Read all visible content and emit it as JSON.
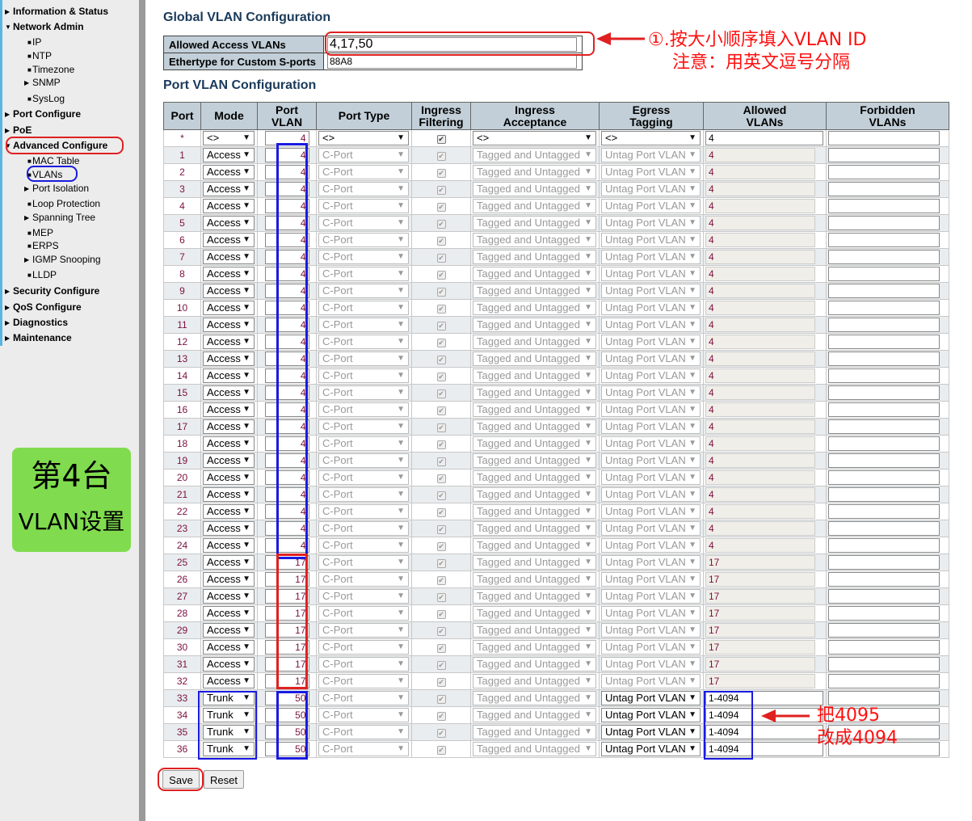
{
  "sidebar": {
    "items": [
      {
        "label": "Information & Status",
        "level": 0,
        "arrow": "right"
      },
      {
        "label": "Network Admin",
        "level": 0,
        "arrow": "down"
      },
      {
        "label": "IP",
        "level": 1
      },
      {
        "label": "NTP",
        "level": 1
      },
      {
        "label": "Timezone",
        "level": 1
      },
      {
        "label": "SNMP",
        "level": 1,
        "arrow": "right"
      },
      {
        "label": "SysLog",
        "level": 1
      },
      {
        "label": "Port Configure",
        "level": 0,
        "arrow": "right"
      },
      {
        "label": "PoE",
        "level": 0,
        "arrow": "right"
      },
      {
        "label": "Advanced Configure",
        "level": 0,
        "arrow": "down"
      },
      {
        "label": "MAC Table",
        "level": 1
      },
      {
        "label": "VLANs",
        "level": 1
      },
      {
        "label": "Port Isolation",
        "level": 1,
        "arrow": "right"
      },
      {
        "label": "Loop Protection",
        "level": 1
      },
      {
        "label": "Spanning Tree",
        "level": 1,
        "arrow": "right"
      },
      {
        "label": "MEP",
        "level": 1
      },
      {
        "label": "ERPS",
        "level": 1
      },
      {
        "label": "IGMP Snooping",
        "level": 1,
        "arrow": "right"
      },
      {
        "label": "LLDP",
        "level": 1
      },
      {
        "label": "Security Configure",
        "level": 0,
        "arrow": "right"
      },
      {
        "label": "QoS Configure",
        "level": 0,
        "arrow": "right"
      },
      {
        "label": "Diagnostics",
        "level": 0,
        "arrow": "right"
      },
      {
        "label": "Maintenance",
        "level": 0,
        "arrow": "right"
      }
    ],
    "badge": {
      "line1": "第4台",
      "line2": "VLAN设置",
      "color": "#80dc4e"
    }
  },
  "global": {
    "title": "Global VLAN Configuration",
    "allowed_label": "Allowed Access VLANs",
    "allowed_value": "4,17,50",
    "ethertype_label": "Ethertype for Custom S-ports",
    "ethertype_value": "88A8"
  },
  "port_section": {
    "title": "Port VLAN Configuration",
    "headers": {
      "port": "Port",
      "mode": "Mode",
      "pvid_1": "Port",
      "pvid_2": "VLAN",
      "type": "Port Type",
      "filter_1": "Ingress",
      "filter_2": "Filtering",
      "accept_1": "Ingress",
      "accept_2": "Acceptance",
      "egress_1": "Egress",
      "egress_2": "Tagging",
      "allowed_1": "Allowed",
      "allowed_2": "VLANs",
      "forbidden_1": "Forbidden",
      "forbidden_2": "VLANs"
    },
    "wildcard": {
      "port": "*",
      "mode": "<>",
      "pvid": "4",
      "type": "<>",
      "accept": "<>",
      "egress": "<>",
      "allowed": "4",
      "forbidden": ""
    },
    "rows": [
      {
        "port": "1",
        "mode": "Access",
        "pvid": "4",
        "type": "C-Port",
        "accept": "Tagged and Untagged",
        "egress": "Untag Port VLAN",
        "allowed": "4",
        "forbidden": ""
      },
      {
        "port": "2",
        "mode": "Access",
        "pvid": "4",
        "type": "C-Port",
        "accept": "Tagged and Untagged",
        "egress": "Untag Port VLAN",
        "allowed": "4",
        "forbidden": ""
      },
      {
        "port": "3",
        "mode": "Access",
        "pvid": "4",
        "type": "C-Port",
        "accept": "Tagged and Untagged",
        "egress": "Untag Port VLAN",
        "allowed": "4",
        "forbidden": ""
      },
      {
        "port": "4",
        "mode": "Access",
        "pvid": "4",
        "type": "C-Port",
        "accept": "Tagged and Untagged",
        "egress": "Untag Port VLAN",
        "allowed": "4",
        "forbidden": ""
      },
      {
        "port": "5",
        "mode": "Access",
        "pvid": "4",
        "type": "C-Port",
        "accept": "Tagged and Untagged",
        "egress": "Untag Port VLAN",
        "allowed": "4",
        "forbidden": ""
      },
      {
        "port": "6",
        "mode": "Access",
        "pvid": "4",
        "type": "C-Port",
        "accept": "Tagged and Untagged",
        "egress": "Untag Port VLAN",
        "allowed": "4",
        "forbidden": ""
      },
      {
        "port": "7",
        "mode": "Access",
        "pvid": "4",
        "type": "C-Port",
        "accept": "Tagged and Untagged",
        "egress": "Untag Port VLAN",
        "allowed": "4",
        "forbidden": ""
      },
      {
        "port": "8",
        "mode": "Access",
        "pvid": "4",
        "type": "C-Port",
        "accept": "Tagged and Untagged",
        "egress": "Untag Port VLAN",
        "allowed": "4",
        "forbidden": ""
      },
      {
        "port": "9",
        "mode": "Access",
        "pvid": "4",
        "type": "C-Port",
        "accept": "Tagged and Untagged",
        "egress": "Untag Port VLAN",
        "allowed": "4",
        "forbidden": ""
      },
      {
        "port": "10",
        "mode": "Access",
        "pvid": "4",
        "type": "C-Port",
        "accept": "Tagged and Untagged",
        "egress": "Untag Port VLAN",
        "allowed": "4",
        "forbidden": ""
      },
      {
        "port": "11",
        "mode": "Access",
        "pvid": "4",
        "type": "C-Port",
        "accept": "Tagged and Untagged",
        "egress": "Untag Port VLAN",
        "allowed": "4",
        "forbidden": ""
      },
      {
        "port": "12",
        "mode": "Access",
        "pvid": "4",
        "type": "C-Port",
        "accept": "Tagged and Untagged",
        "egress": "Untag Port VLAN",
        "allowed": "4",
        "forbidden": ""
      },
      {
        "port": "13",
        "mode": "Access",
        "pvid": "4",
        "type": "C-Port",
        "accept": "Tagged and Untagged",
        "egress": "Untag Port VLAN",
        "allowed": "4",
        "forbidden": ""
      },
      {
        "port": "14",
        "mode": "Access",
        "pvid": "4",
        "type": "C-Port",
        "accept": "Tagged and Untagged",
        "egress": "Untag Port VLAN",
        "allowed": "4",
        "forbidden": ""
      },
      {
        "port": "15",
        "mode": "Access",
        "pvid": "4",
        "type": "C-Port",
        "accept": "Tagged and Untagged",
        "egress": "Untag Port VLAN",
        "allowed": "4",
        "forbidden": ""
      },
      {
        "port": "16",
        "mode": "Access",
        "pvid": "4",
        "type": "C-Port",
        "accept": "Tagged and Untagged",
        "egress": "Untag Port VLAN",
        "allowed": "4",
        "forbidden": ""
      },
      {
        "port": "17",
        "mode": "Access",
        "pvid": "4",
        "type": "C-Port",
        "accept": "Tagged and Untagged",
        "egress": "Untag Port VLAN",
        "allowed": "4",
        "forbidden": ""
      },
      {
        "port": "18",
        "mode": "Access",
        "pvid": "4",
        "type": "C-Port",
        "accept": "Tagged and Untagged",
        "egress": "Untag Port VLAN",
        "allowed": "4",
        "forbidden": ""
      },
      {
        "port": "19",
        "mode": "Access",
        "pvid": "4",
        "type": "C-Port",
        "accept": "Tagged and Untagged",
        "egress": "Untag Port VLAN",
        "allowed": "4",
        "forbidden": ""
      },
      {
        "port": "20",
        "mode": "Access",
        "pvid": "4",
        "type": "C-Port",
        "accept": "Tagged and Untagged",
        "egress": "Untag Port VLAN",
        "allowed": "4",
        "forbidden": ""
      },
      {
        "port": "21",
        "mode": "Access",
        "pvid": "4",
        "type": "C-Port",
        "accept": "Tagged and Untagged",
        "egress": "Untag Port VLAN",
        "allowed": "4",
        "forbidden": ""
      },
      {
        "port": "22",
        "mode": "Access",
        "pvid": "4",
        "type": "C-Port",
        "accept": "Tagged and Untagged",
        "egress": "Untag Port VLAN",
        "allowed": "4",
        "forbidden": ""
      },
      {
        "port": "23",
        "mode": "Access",
        "pvid": "4",
        "type": "C-Port",
        "accept": "Tagged and Untagged",
        "egress": "Untag Port VLAN",
        "allowed": "4",
        "forbidden": ""
      },
      {
        "port": "24",
        "mode": "Access",
        "pvid": "4",
        "type": "C-Port",
        "accept": "Tagged and Untagged",
        "egress": "Untag Port VLAN",
        "allowed": "4",
        "forbidden": ""
      },
      {
        "port": "25",
        "mode": "Access",
        "pvid": "17",
        "type": "C-Port",
        "accept": "Tagged and Untagged",
        "egress": "Untag Port VLAN",
        "allowed": "17",
        "forbidden": ""
      },
      {
        "port": "26",
        "mode": "Access",
        "pvid": "17",
        "type": "C-Port",
        "accept": "Tagged and Untagged",
        "egress": "Untag Port VLAN",
        "allowed": "17",
        "forbidden": ""
      },
      {
        "port": "27",
        "mode": "Access",
        "pvid": "17",
        "type": "C-Port",
        "accept": "Tagged and Untagged",
        "egress": "Untag Port VLAN",
        "allowed": "17",
        "forbidden": ""
      },
      {
        "port": "28",
        "mode": "Access",
        "pvid": "17",
        "type": "C-Port",
        "accept": "Tagged and Untagged",
        "egress": "Untag Port VLAN",
        "allowed": "17",
        "forbidden": ""
      },
      {
        "port": "29",
        "mode": "Access",
        "pvid": "17",
        "type": "C-Port",
        "accept": "Tagged and Untagged",
        "egress": "Untag Port VLAN",
        "allowed": "17",
        "forbidden": ""
      },
      {
        "port": "30",
        "mode": "Access",
        "pvid": "17",
        "type": "C-Port",
        "accept": "Tagged and Untagged",
        "egress": "Untag Port VLAN",
        "allowed": "17",
        "forbidden": ""
      },
      {
        "port": "31",
        "mode": "Access",
        "pvid": "17",
        "type": "C-Port",
        "accept": "Tagged and Untagged",
        "egress": "Untag Port VLAN",
        "allowed": "17",
        "forbidden": ""
      },
      {
        "port": "32",
        "mode": "Access",
        "pvid": "17",
        "type": "C-Port",
        "accept": "Tagged and Untagged",
        "egress": "Untag Port VLAN",
        "allowed": "17",
        "forbidden": ""
      },
      {
        "port": "33",
        "mode": "Trunk",
        "pvid": "50",
        "type": "C-Port",
        "accept": "Tagged and Untagged",
        "egress": "Untag Port VLAN",
        "allowed": "1-4094",
        "forbidden": ""
      },
      {
        "port": "34",
        "mode": "Trunk",
        "pvid": "50",
        "type": "C-Port",
        "accept": "Tagged and Untagged",
        "egress": "Untag Port VLAN",
        "allowed": "1-4094",
        "forbidden": ""
      },
      {
        "port": "35",
        "mode": "Trunk",
        "pvid": "50",
        "type": "C-Port",
        "accept": "Tagged and Untagged",
        "egress": "Untag Port VLAN",
        "allowed": "1-4094",
        "forbidden": ""
      },
      {
        "port": "36",
        "mode": "Trunk",
        "pvid": "50",
        "type": "C-Port",
        "accept": "Tagged and Untagged",
        "egress": "Untag Port VLAN",
        "allowed": "1-4094",
        "forbidden": ""
      }
    ]
  },
  "buttons": {
    "save": "Save",
    "reset": "Reset"
  },
  "annotations": {
    "note1_line1": "①.按大小顺序填入VLAN ID",
    "note1_line2": "注意：用英文逗号分隔",
    "note2_line1": "把4095",
    "note2_line2": "改成4094",
    "red": "#e02020",
    "blue": "#1a1ae0"
  }
}
